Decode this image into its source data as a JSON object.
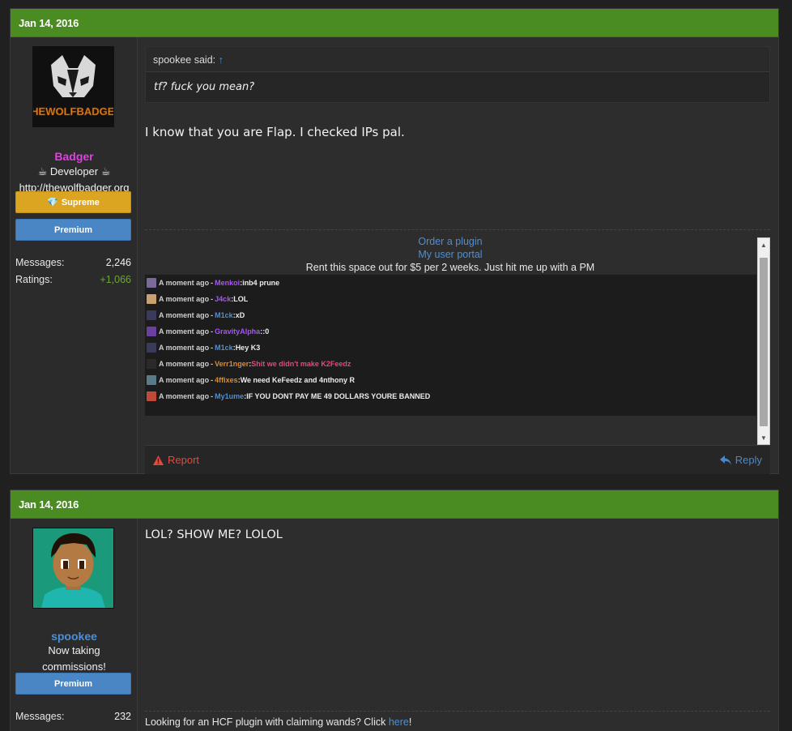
{
  "posts": [
    {
      "date": "Jan 14, 2016",
      "user": {
        "name": "Badger",
        "name_color": "#e040e0",
        "title": "Developer",
        "website": "http://thewolfbadger.org",
        "avatar_text": "THEWOLFBADGER",
        "badges": [
          "Supreme",
          "Premium"
        ],
        "stats": [
          {
            "label": "Messages:",
            "value": "2,246"
          },
          {
            "label": "Ratings:",
            "value": "+1,066"
          }
        ]
      },
      "quote": {
        "author": "spookee said:",
        "arrow": "↑",
        "text": "tf? fuck you mean?"
      },
      "message": "I know that you are Flap. I checked IPs pal.",
      "signature": {
        "links": [
          "Order a plugin",
          "My user portal"
        ],
        "note": "Rent this space out for $5 per 2 weeks. Just hit me up with a PM"
      },
      "shoutbox": [
        {
          "time": "A moment ago",
          "user": "Menkoi",
          "user_color": "#a855f7",
          "text": "inb4 prune",
          "text_color": "#ececec",
          "icon_color": "#7a6a9a"
        },
        {
          "time": "A moment ago",
          "user": "J4ck",
          "user_color": "#a855f7",
          "text": "LOL",
          "text_color": "#ececec",
          "icon_color": "#c9a070"
        },
        {
          "time": "A moment ago",
          "user": "M1ck",
          "user_color": "#4a90d9",
          "text": "xD",
          "text_color": "#ececec",
          "icon_color": "#3a3a5a"
        },
        {
          "time": "A moment ago",
          "user": "GravityAlpha",
          "user_color": "#a855f7",
          "text": ":0",
          "text_color": "#ececec",
          "icon_color": "#6b3fa0"
        },
        {
          "time": "A moment ago",
          "user": "M1ck",
          "user_color": "#4a90d9",
          "text": "Hey K3",
          "text_color": "#ececec",
          "icon_color": "#3a3a5a"
        },
        {
          "time": "A moment ago",
          "user": "Verr1nger",
          "user_color": "#e08a2a",
          "text": "Shit we didn't make K2Feedz",
          "text_color": "#e24a7a",
          "icon_color": "#2a2a2a"
        },
        {
          "time": "A moment ago",
          "user": "4ffixes",
          "user_color": "#e08a2a",
          "text": "We need KeFeedz and 4nthony R",
          "text_color": "#ececec",
          "icon_color": "#5a7a8a"
        },
        {
          "time": "A moment ago",
          "user": "My1ume",
          "user_color": "#4a90d9",
          "text": "IF YOU DONT PAY ME 49 DOLLARS YOURE BANNED",
          "text_color": "#ececec",
          "icon_color": "#c04a3a"
        }
      ],
      "actions": {
        "report": "Report",
        "reply": "Reply"
      }
    },
    {
      "date": "Jan 14, 2016",
      "user": {
        "name": "spookee",
        "name_color": "#4a90d9",
        "title_line1": "Now taking",
        "title_line2": "commissions!",
        "badges": [
          "Premium"
        ],
        "stats": [
          {
            "label": "Messages:",
            "value": "232"
          }
        ]
      },
      "message": "LOL? SHOW ME? LOLOL",
      "signature": {
        "prefix": "Looking for an HCF plugin with claiming wands? Click ",
        "link": "here",
        "suffix": "!"
      }
    }
  ]
}
